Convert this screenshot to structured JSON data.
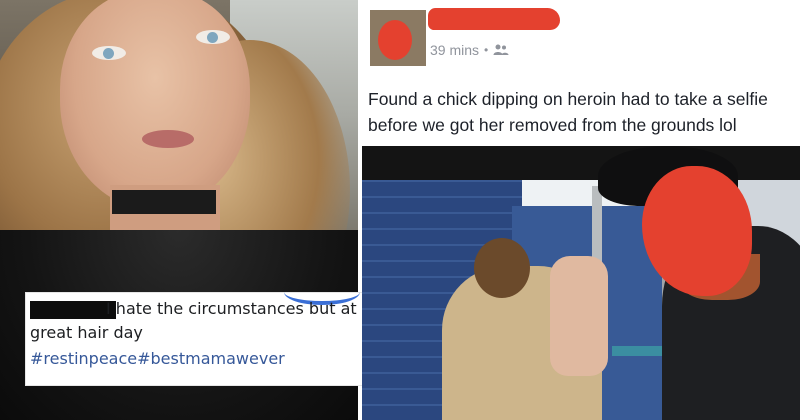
{
  "caption_overlay": {
    "line1": "I hate the circumstances but at least I'm having a",
    "line2": "great hair day",
    "hashtags": "#restinpeace#bestmamawever"
  },
  "post": {
    "timestamp": "39 mins",
    "audience_icon": "friends-icon",
    "text": "Found a chick dipping on heroin had to take a selfie before we got her removed from the grounds lol"
  },
  "colors": {
    "redaction_red": "#e4412f",
    "hashtag_blue": "#365899",
    "meta_gray": "#90949c"
  }
}
